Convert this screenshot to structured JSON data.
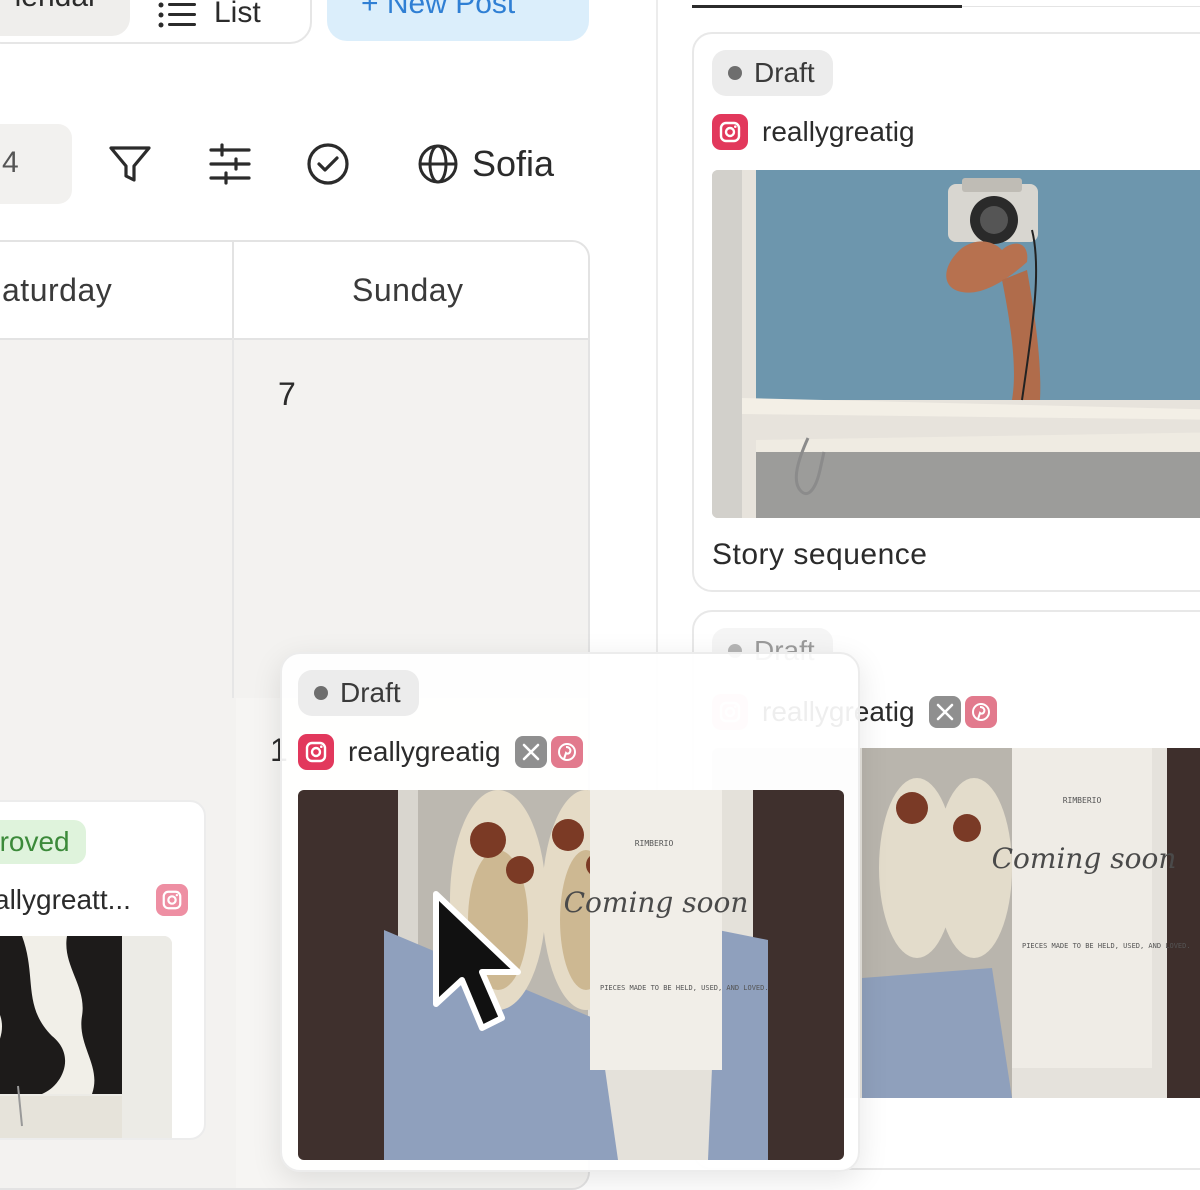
{
  "header": {
    "calendar_label": "lendar",
    "list_label": "List",
    "new_post_label": "+ New Post"
  },
  "toolbar": {
    "date_fragment": "4",
    "timezone": "Sofia",
    "icons": [
      "filter-icon",
      "sliders-icon",
      "check-circle-icon",
      "globe-icon"
    ]
  },
  "calendar": {
    "days": [
      "aturday",
      "Sunday"
    ],
    "sunday_date": "7",
    "next_row_date_fragment": "1",
    "approved_card": {
      "status": "proved",
      "handle": "allygreatt..."
    }
  },
  "dragging_card": {
    "status": "Draft",
    "handle": "reallygreatig",
    "image_texts": {
      "brand": "RIMBERIO",
      "headline": "Coming soon",
      "body": "PIECES MADE TO BE HELD, USED, AND LOVED."
    }
  },
  "panel": {
    "cards": [
      {
        "status": "Draft",
        "handle": "reallygreatig",
        "caption": "Story sequence"
      },
      {
        "status": "Draft",
        "handle": "reallygreatig",
        "image_texts": {
          "brand": "RIMBERIO",
          "headline": "Coming soon",
          "body": "PIECES MADE TO BE HELD, USED, AND LOVED."
        }
      }
    ]
  },
  "colors": {
    "accent_blue": "#2f7fd4",
    "new_post_bg": "#dbeefb",
    "instagram": "#e2385c",
    "approved_green": "#3c8a3a",
    "approved_bg": "#dff3dc",
    "draft_bg": "#ececec"
  }
}
